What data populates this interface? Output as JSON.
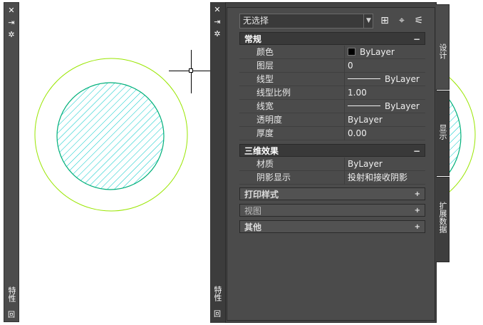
{
  "left_palette": {
    "close_glyph": "✕",
    "autohide_glyph": "⇥",
    "settings_glyph": "✲",
    "title": "特性",
    "bottom_glyph": "回"
  },
  "palette": {
    "close_glyph": "✕",
    "autohide_glyph": "⇥",
    "settings_glyph": "✲",
    "title": "特性",
    "bottom_glyph": "回",
    "selection": {
      "value": "无选择",
      "dropdown_glyph": "▼"
    },
    "toolbar": {
      "toggle_pickadd_glyph": "⊞",
      "select_objects_glyph": "⌖",
      "quick_select_glyph": "⚟"
    },
    "categories": [
      {
        "title": "常规",
        "toggle": "−",
        "rows": [
          {
            "label": "颜色",
            "value": "ByLayer"
          },
          {
            "label": "图层",
            "value": "0"
          },
          {
            "label": "线型",
            "value": "ByLayer"
          },
          {
            "label": "线型比例",
            "value": "1.00"
          },
          {
            "label": "线宽",
            "value": "ByLayer"
          },
          {
            "label": "透明度",
            "value": "ByLayer"
          },
          {
            "label": "厚度",
            "value": "0.00"
          }
        ]
      },
      {
        "title": "三维效果",
        "toggle": "−",
        "rows": [
          {
            "label": "材质",
            "value": "ByLayer"
          },
          {
            "label": "阴影显示",
            "value": "投射和接收阴影"
          }
        ]
      },
      {
        "title": "打印样式",
        "toggle": "+"
      },
      {
        "title": "视图",
        "toggle": "+"
      },
      {
        "title": "其他",
        "toggle": "+"
      }
    ],
    "side_tabs": [
      {
        "label": "设计",
        "active": true
      },
      {
        "label": "显示",
        "active": false
      },
      {
        "label": "扩展数据",
        "active": false
      }
    ]
  },
  "colors": {
    "outer_circle": "#99e600",
    "inner_circle": "#00b07a",
    "hatch": "#00c8c8"
  }
}
